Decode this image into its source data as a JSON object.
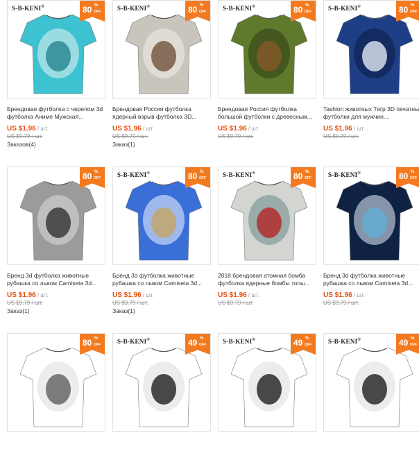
{
  "colors": {
    "accent": "#f47a1f",
    "price": "#e64e0e"
  },
  "products": [
    {
      "brand": "S-B-KENI",
      "discount": "80",
      "pct": "%",
      "off": "OFF",
      "title": "Брендовая футболка с черепом 3d футболка Аниме Мужская...",
      "price": "US $1.96",
      "unit": " / шт.",
      "old_price": "US $9.79 / шт.",
      "orders": "Заказов(4)",
      "icon": "skull-tshirt-image",
      "colors": [
        "#3cc2d0",
        "#1f7f8a",
        "#e8f3f0"
      ]
    },
    {
      "brand": "S-B-KENI",
      "discount": "80",
      "pct": "%",
      "off": "OFF",
      "title": "Брендовая Россия футболка ядерный взрыв футболка 3D...",
      "price": "US $1.96",
      "unit": " / шт.",
      "old_price": "US $9.79 / шт.",
      "orders": "Заказ(1)",
      "icon": "mushroom-cloud-tshirt-image",
      "colors": [
        "#c9c5bd",
        "#6a4a32",
        "#f2efe9"
      ]
    },
    {
      "brand": "S-B-KENI",
      "discount": "80",
      "pct": "%",
      "off": "OFF",
      "title": "Брендовая Россия футболка большой футболки с древесным...",
      "price": "US $1.96",
      "unit": " / шт.",
      "old_price": "US $9.79 / шт.",
      "orders": "",
      "icon": "tree-tshirt-image",
      "colors": [
        "#5f7a2c",
        "#8a5a2a",
        "#2e3a15"
      ]
    },
    {
      "brand": "S-B-KENI",
      "discount": "80",
      "pct": "%",
      "off": "OFF",
      "title": "Tashion животных Тигр 3D печатных футболки для мужчин...",
      "price": "US $1.96",
      "unit": " / шт.",
      "old_price": "US $9.79 / шт.",
      "orders": "",
      "icon": "tiger-tshirt-image",
      "colors": [
        "#1e3f86",
        "#f0f4ff",
        "#0c1c44"
      ]
    },
    {
      "brand": "",
      "discount": "80",
      "pct": "%",
      "off": "OFF",
      "title": "Бренд 3d футболка животные рубашка со львом Camiseta 3d...",
      "price": "US $1.96",
      "unit": " / шт.",
      "old_price": "US $9.79 / шт.",
      "orders": "Заказ(1)",
      "icon": "lion-tshirt-image",
      "colors": [
        "#9b9b9b",
        "#2a2a2a",
        "#dcdcdc"
      ]
    },
    {
      "brand": "S-B-KENI",
      "discount": "80",
      "pct": "%",
      "off": "OFF",
      "title": "Бренд 3d футболка животные рубашка со львом Camiseta 3d...",
      "price": "US $1.96",
      "unit": " / шт.",
      "old_price": "US $9.79 / шт.",
      "orders": "Заказ(1)",
      "icon": "lightning-cat-tshirt-image",
      "colors": [
        "#3a6fd8",
        "#c7a35a",
        "#f4f6ff"
      ]
    },
    {
      "brand": "S-B-KENI",
      "discount": "80",
      "pct": "%",
      "off": "OFF",
      "title": "2018 брендовая атомная бомба футболка ядерные бомбы топы...",
      "price": "US $1.96",
      "unit": " / шт.",
      "old_price": "US $9.79 / шт.",
      "orders": "",
      "icon": "atomic-bomb-tshirt-image",
      "colors": [
        "#d2d5d0",
        "#b51c1c",
        "#6b8b8b"
      ]
    },
    {
      "brand": "S-B-KENI",
      "discount": "80",
      "pct": "%",
      "off": "OFF",
      "title": "Бренд 3d футболка животные рубашка со львом Camiseta 3d...",
      "price": "US $1.96",
      "unit": " / шт.",
      "old_price": "US $9.79 / шт.",
      "orders": "",
      "icon": "skeleton-hand-tshirt-image",
      "colors": [
        "#0f2244",
        "#5fb0d8",
        "#e9f3ff"
      ]
    },
    {
      "brand": "",
      "discount": "80",
      "pct": "%",
      "off": "OFF",
      "title": "",
      "price": "",
      "unit": "",
      "old_price": "",
      "orders": "",
      "icon": "tshirt-image",
      "colors": [
        "#ffffff",
        "#555555",
        "#dddddd"
      ]
    },
    {
      "brand": "S-B-KENI",
      "discount": "49",
      "pct": "%",
      "off": "OFF",
      "title": "",
      "price": "",
      "unit": "",
      "old_price": "",
      "orders": "",
      "icon": "tshirt-image",
      "colors": [
        "#ffffff",
        "#111111",
        "#dddddd"
      ]
    },
    {
      "brand": "S-B-KENI",
      "discount": "49",
      "pct": "%",
      "off": "OFF",
      "title": "",
      "price": "",
      "unit": "",
      "old_price": "",
      "orders": "",
      "icon": "tshirt-image",
      "colors": [
        "#ffffff",
        "#111111",
        "#dddddd"
      ]
    },
    {
      "brand": "S-B-KENI",
      "discount": "49",
      "pct": "%",
      "off": "OFF",
      "title": "",
      "price": "",
      "unit": "",
      "old_price": "",
      "orders": "",
      "icon": "tshirt-image",
      "colors": [
        "#ffffff",
        "#111111",
        "#dddddd"
      ]
    }
  ]
}
